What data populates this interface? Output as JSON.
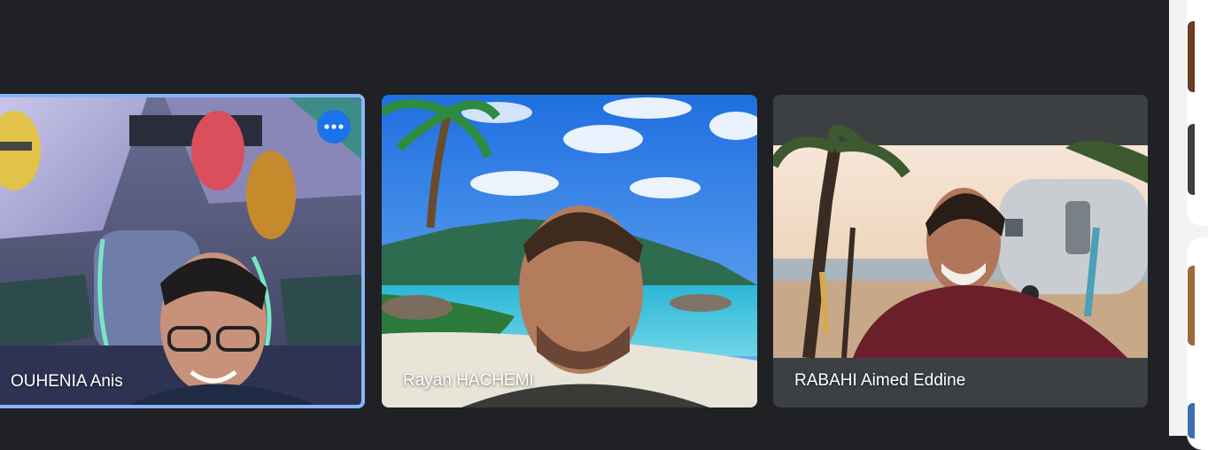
{
  "participants": [
    {
      "name": "OUHENIA Anis",
      "active_speaker": true
    },
    {
      "name": "Rayan HACHEMI",
      "active_speaker": false
    },
    {
      "name": "RABAHI Aimed Eddine",
      "active_speaker": false
    }
  ],
  "colors": {
    "stage_background": "#202124",
    "active_border": "#8ab4f8",
    "menu_button": "#1a73e8",
    "side_panel": "#f1f3f4"
  },
  "icons": {
    "tile_menu": "more-options-icon"
  }
}
